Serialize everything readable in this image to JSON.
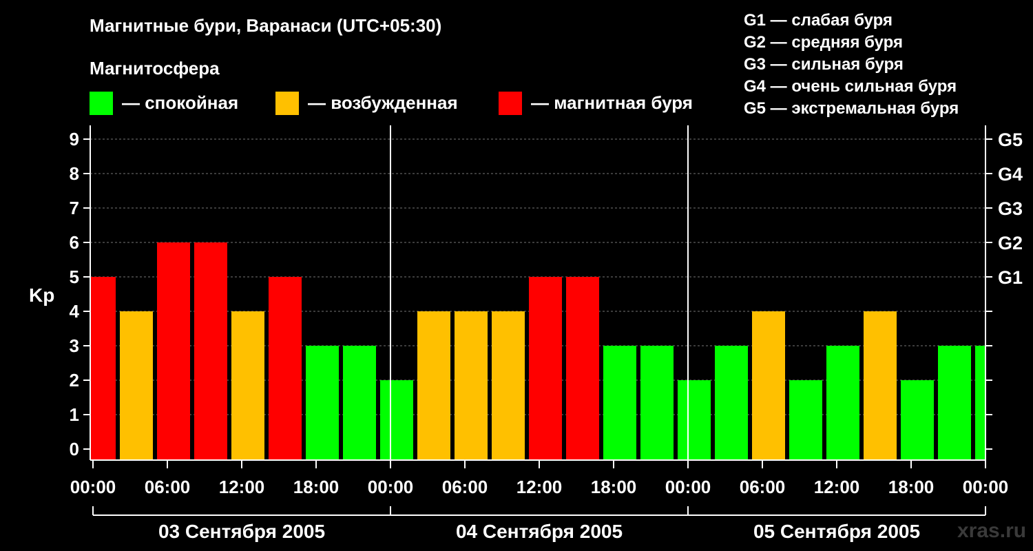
{
  "title": "Магнитные бури, Варанаси (UTC+05:30)",
  "subtitle": "Магнитосфера",
  "legend": [
    {
      "label": "— спокойная",
      "color": "#00ff00"
    },
    {
      "label": "— возбужденная",
      "color": "#ffc000"
    },
    {
      "label": "— магнитная буря",
      "color": "#ff0000"
    }
  ],
  "g_legend": [
    "G1 — слабая буря",
    "G2 — средняя буря",
    "G3 — сильная буря",
    "G4 — очень сильная буря",
    "G5 — экстремальная буря"
  ],
  "watermark": "xras.ru",
  "chart_data": {
    "type": "bar",
    "ylabel": "Kp",
    "ylim": [
      0,
      9
    ],
    "y_ticks": [
      "0",
      "1",
      "2",
      "3",
      "4",
      "5",
      "6",
      "7",
      "8",
      "9"
    ],
    "right_ticks": [
      {
        "value": 5,
        "label": "G1"
      },
      {
        "value": 6,
        "label": "G2"
      },
      {
        "value": 7,
        "label": "G3"
      },
      {
        "value": 8,
        "label": "G4"
      },
      {
        "value": 9,
        "label": "G5"
      }
    ],
    "x_tick_labels": [
      "00:00",
      "06:00",
      "12:00",
      "18:00",
      "00:00",
      "06:00",
      "12:00",
      "18:00",
      "00:00",
      "06:00",
      "12:00",
      "18:00",
      "00:00"
    ],
    "dates": [
      "03 Сентября 2005",
      "04 Сентября 2005",
      "05 Сентября 2005"
    ],
    "grid": true,
    "colors": {
      "quiet": "#00ff00",
      "active": "#ffc000",
      "storm": "#ff0000"
    },
    "values": [
      5,
      4,
      6,
      6,
      4,
      5,
      3,
      3,
      2,
      4,
      4,
      4,
      5,
      5,
      3,
      3,
      2,
      3,
      4,
      2,
      3,
      4,
      2,
      3,
      3
    ]
  }
}
